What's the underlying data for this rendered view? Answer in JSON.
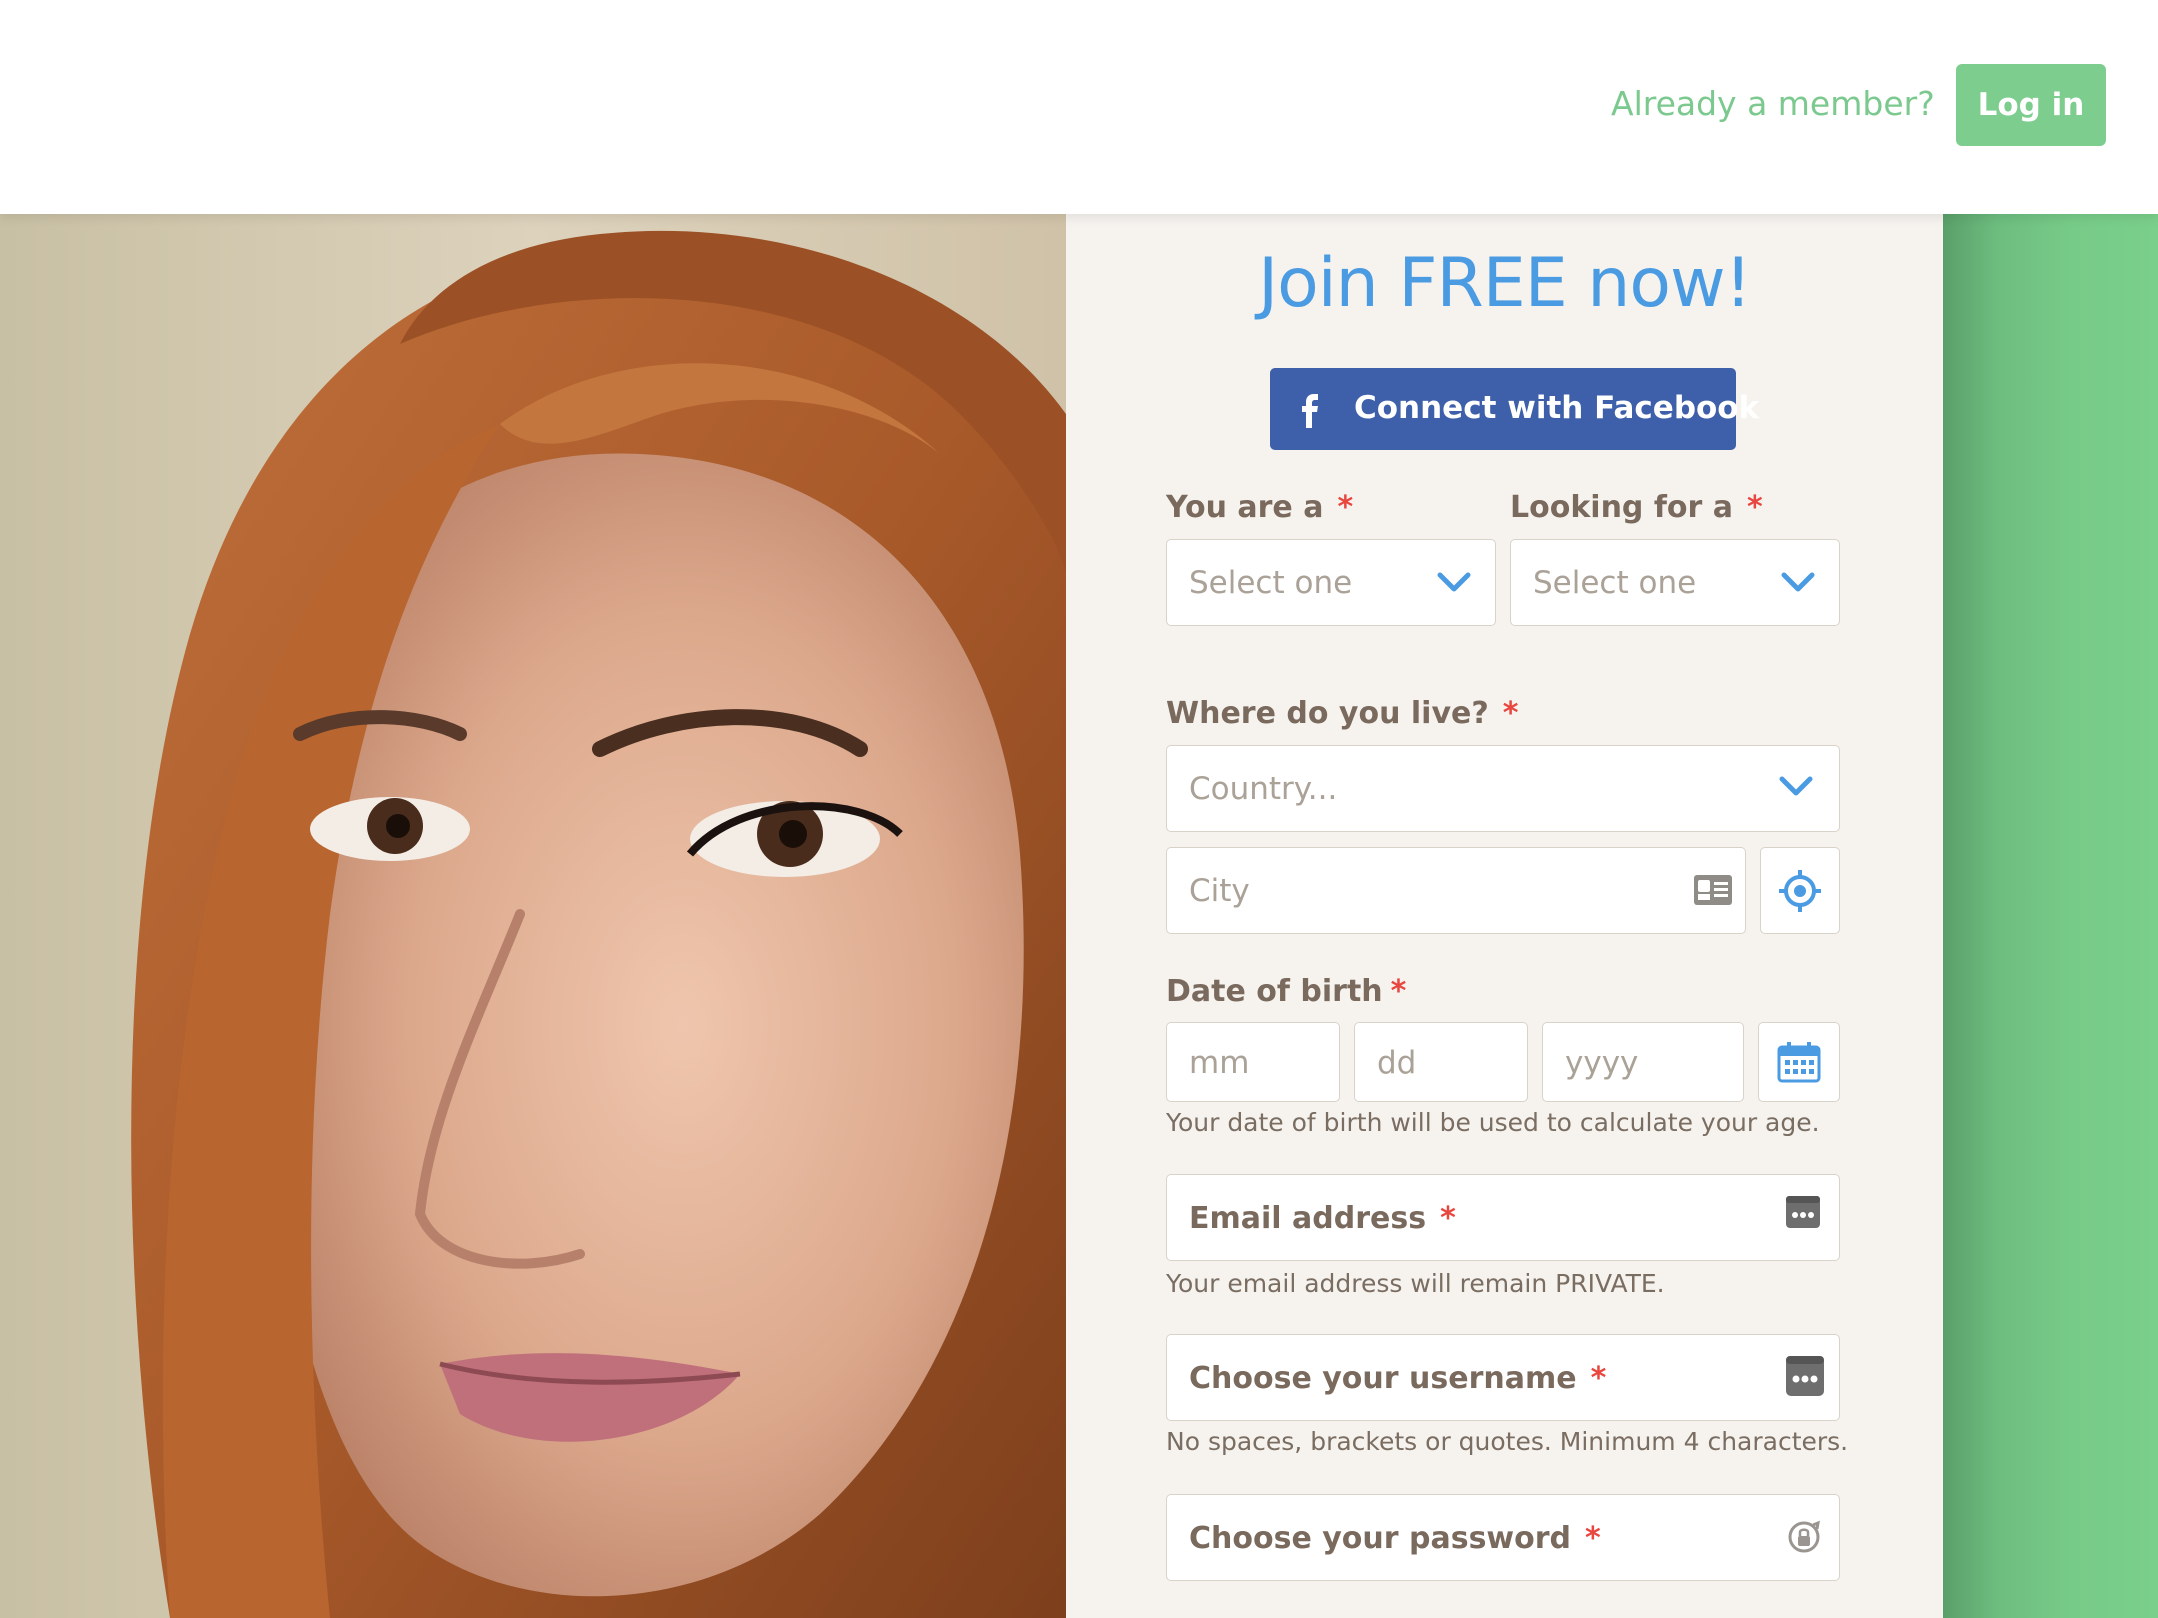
{
  "header": {
    "already_member": "Already a member?",
    "login_label": "Log in"
  },
  "form": {
    "title": "Join FREE now!",
    "facebook_label": "Connect with Facebook",
    "you_are": {
      "label": "You are a",
      "required": "*",
      "placeholder": "Select one"
    },
    "looking_for": {
      "label": "Looking for a",
      "required": "*",
      "placeholder": "Select one"
    },
    "location": {
      "label": "Where do you live?",
      "required": "*",
      "country_placeholder": "Country...",
      "city_placeholder": "City"
    },
    "dob": {
      "label": "Date of birth",
      "required": "*",
      "mm": "mm",
      "dd": "dd",
      "yyyy": "yyyy",
      "help": "Your date of birth will be used to calculate your age."
    },
    "email": {
      "label": "Email address",
      "required": "*",
      "help": "Your email address will remain PRIVATE."
    },
    "username": {
      "label": "Choose your username",
      "required": "*",
      "help": "No spaces, brackets or quotes. Minimum 4 characters."
    },
    "password": {
      "label": "Choose your password",
      "required": "*"
    }
  },
  "colors": {
    "accent_green": "#7ccd8e",
    "title_blue": "#4a9be2",
    "facebook_blue": "#3e5fa9",
    "required_red": "#e8463f"
  }
}
